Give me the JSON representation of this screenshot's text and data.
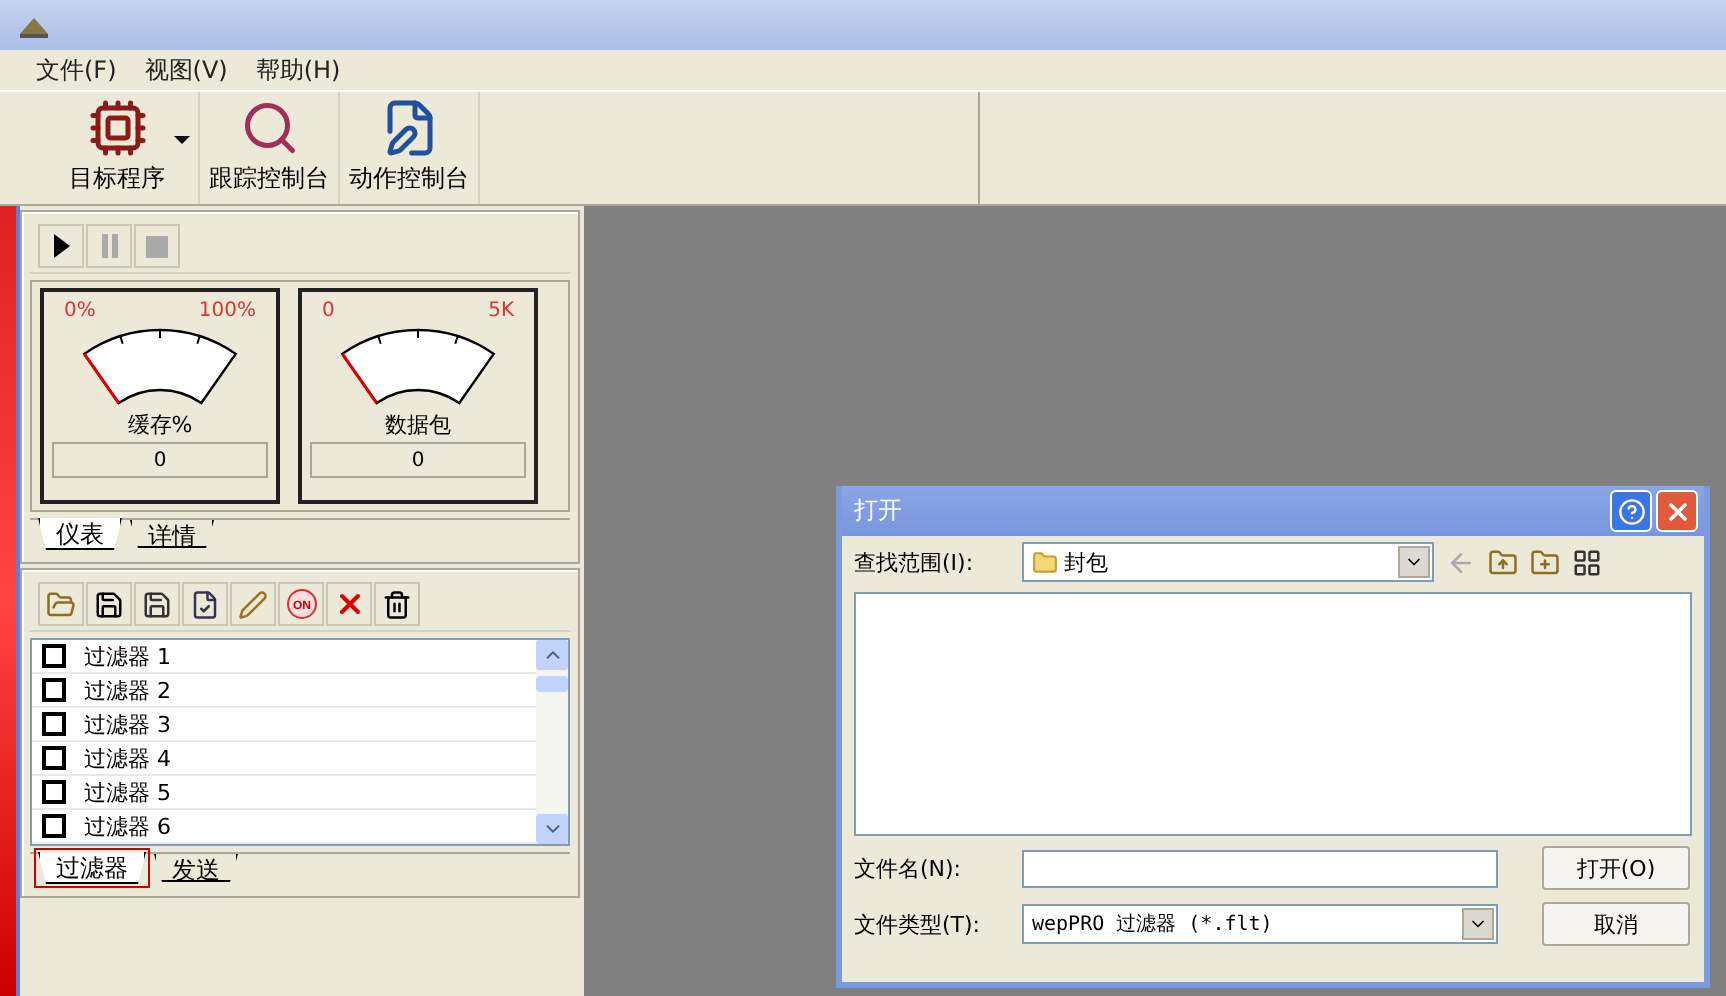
{
  "menu": [
    {
      "label": "文件(F)"
    },
    {
      "label": "视图(V)"
    },
    {
      "label": "帮助(H)"
    }
  ],
  "toolbar": [
    {
      "kind": "chip",
      "label": "目标程序",
      "dropdown": true
    },
    {
      "kind": "trace",
      "label": "跟踪控制台",
      "dropdown": false
    },
    {
      "kind": "action",
      "label": "动作控制台",
      "dropdown": false
    }
  ],
  "media_controls": [
    {
      "kind": "play",
      "disabled": false
    },
    {
      "kind": "pause",
      "disabled": true
    },
    {
      "kind": "stop",
      "disabled": true
    }
  ],
  "gauges": [
    {
      "min": "0%",
      "max": "100%",
      "title": "缓存%",
      "reading": "0",
      "level": 0
    },
    {
      "min": "0",
      "max": "5K",
      "title": "数据包",
      "reading": "0",
      "level": 0
    }
  ],
  "gauge_tabs": [
    {
      "label": "仪表",
      "selected": true
    },
    {
      "label": "详情",
      "selected": false
    }
  ],
  "filter_tools": {
    "toggle_label": "ON"
  },
  "filters": [
    {
      "label": "过滤器 1",
      "checked": false
    },
    {
      "label": "过滤器 2",
      "checked": false
    },
    {
      "label": "过滤器 3",
      "checked": false
    },
    {
      "label": "过滤器 4",
      "checked": false
    },
    {
      "label": "过滤器 5",
      "checked": false
    },
    {
      "label": "过滤器 6",
      "checked": false
    }
  ],
  "filter_tabs": [
    {
      "label": "过滤器",
      "selected": true,
      "highlighted": true
    },
    {
      "label": "发送",
      "selected": false,
      "highlighted": false
    }
  ],
  "dialog": {
    "title": "打开",
    "look_in_label": "查找范围(I):",
    "look_in_value": "封包",
    "file_name_label": "文件名(N):",
    "file_type_label": "文件类型(T):",
    "file_type": "wepPRO 过滤器 (*.flt)",
    "buttons": [
      "打开(O)",
      "取消"
    ]
  }
}
